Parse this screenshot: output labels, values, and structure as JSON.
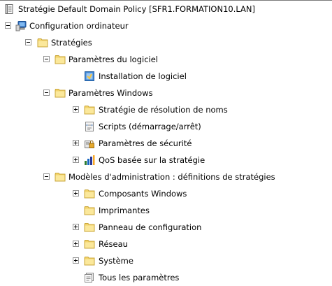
{
  "tree": {
    "root": {
      "label": "Stratégie Default Domain Policy [SFR1.FORMATION10.LAN]",
      "icon": "policy-document-icon"
    },
    "computer_config": {
      "label": "Configuration ordinateur",
      "icon": "computer-icon",
      "expanded": true
    },
    "strategies": {
      "label": "Stratégies",
      "icon": "folder-icon",
      "expanded": true
    },
    "software_settings": {
      "label": "Paramètres du logiciel",
      "icon": "folder-icon",
      "expanded": true
    },
    "software_install": {
      "label": "Installation de logiciel",
      "icon": "software-install-icon"
    },
    "windows_settings": {
      "label": "Paramètres Windows",
      "icon": "folder-icon",
      "expanded": true
    },
    "name_resolution": {
      "label": "Stratégie de résolution de noms",
      "icon": "folder-icon",
      "expanded": false
    },
    "scripts": {
      "label": "Scripts (démarrage/arrêt)",
      "icon": "script-icon"
    },
    "security_settings": {
      "label": "Paramètres de sécurité",
      "icon": "security-icon",
      "expanded": false
    },
    "qos": {
      "label": "QoS basée sur la stratégie",
      "icon": "qos-chart-icon",
      "expanded": false
    },
    "admin_templates": {
      "label": "Modèles d'administration : définitions de stratégies",
      "icon": "folder-icon",
      "expanded": true
    },
    "windows_components": {
      "label": "Composants Windows",
      "icon": "folder-icon",
      "expanded": false
    },
    "printers": {
      "label": "Imprimantes",
      "icon": "folder-icon"
    },
    "control_panel": {
      "label": "Panneau de configuration",
      "icon": "folder-icon",
      "expanded": false
    },
    "network": {
      "label": "Réseau",
      "icon": "folder-icon",
      "expanded": false
    },
    "system": {
      "label": "Système",
      "icon": "folder-icon",
      "expanded": false
    },
    "all_settings": {
      "label": "Tous les paramètres",
      "icon": "all-settings-icon"
    }
  }
}
